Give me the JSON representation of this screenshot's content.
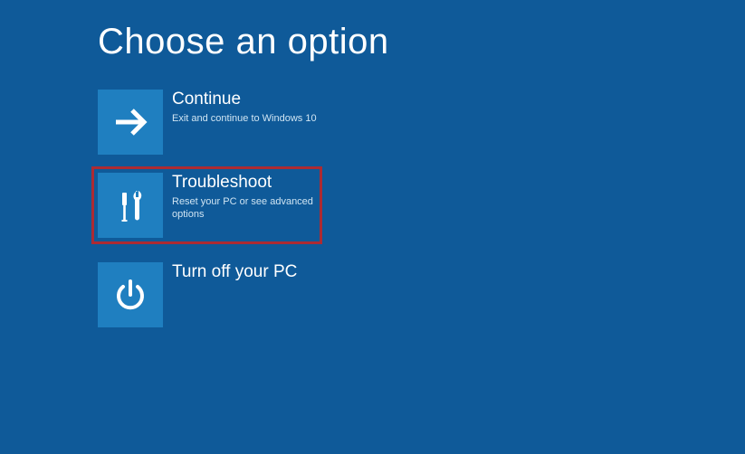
{
  "page": {
    "title": "Choose an option"
  },
  "options": {
    "continue": {
      "label": "Continue",
      "description": "Exit and continue to Windows 10"
    },
    "troubleshoot": {
      "label": "Troubleshoot",
      "description": "Reset your PC or see advanced options"
    },
    "turnoff": {
      "label": "Turn off your PC",
      "description": ""
    }
  },
  "colors": {
    "background": "#0f5a99",
    "tile": "#1f7fc0",
    "highlight": "#ac2b33"
  }
}
